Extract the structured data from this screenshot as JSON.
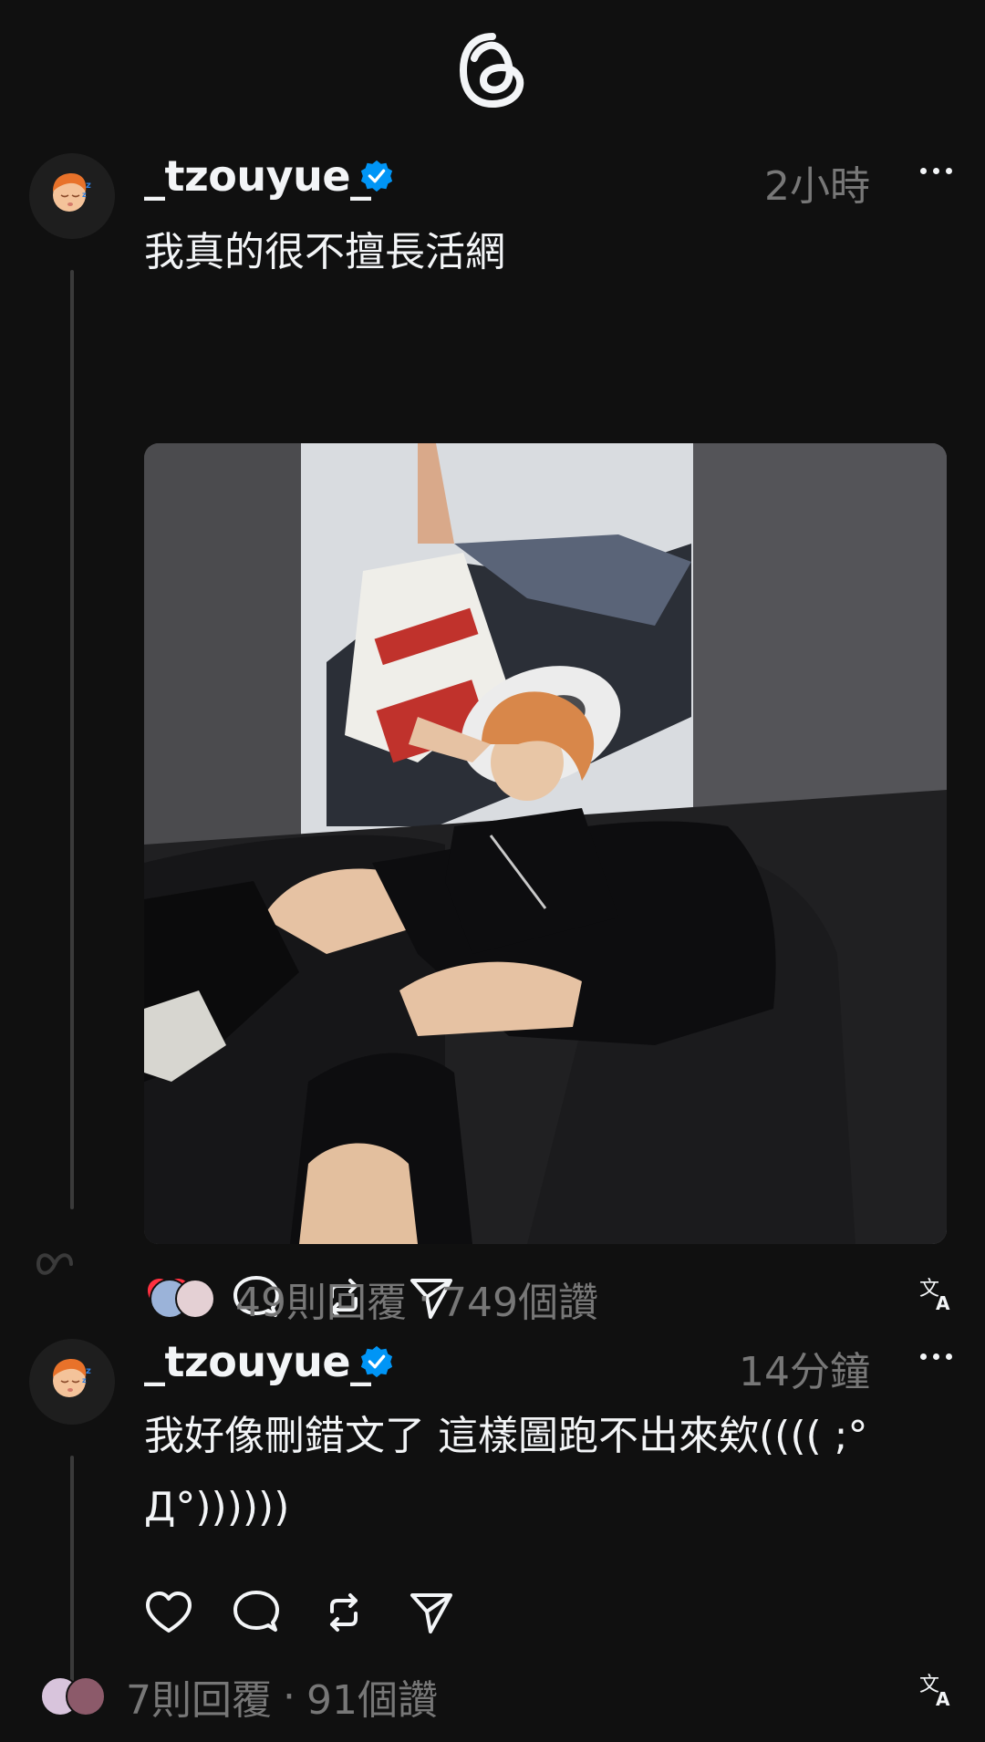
{
  "app": {
    "logo": "threads-logo-icon"
  },
  "posts": [
    {
      "username": "_tzouyue_",
      "verified": true,
      "time": "2小時",
      "text": "我真的很不擅長活網",
      "liked": true,
      "replies": "49則回覆",
      "separator": "·",
      "likes": "749個讚",
      "image": "photo of person with orange hair in black outfit sitting on black leather sofa in front of a painting"
    },
    {
      "username": "_tzouyue_",
      "verified": true,
      "time": "14分鐘",
      "text": "我好像刪錯文了 這樣圖跑不出來欸(((( ;°Д°))))))",
      "liked": false,
      "replies": "7則回覆",
      "separator": "·",
      "likes": "91個讚"
    }
  ],
  "colors": {
    "background": "#101010",
    "text": "#f3f5f7",
    "muted": "#777777",
    "verified": "#0095f6",
    "like": "#ff3040"
  }
}
